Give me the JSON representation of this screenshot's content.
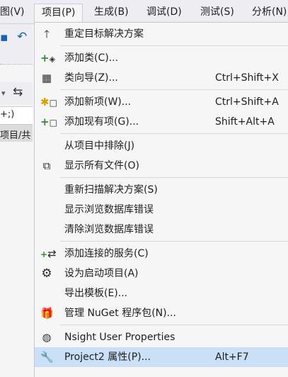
{
  "menubar": {
    "items": [
      "图(V)",
      "项目(P)",
      "生成(B)",
      "调试(D)",
      "测试(S)",
      "分析(N)"
    ]
  },
  "background": {
    "search_text": "+;)",
    "tree_row_text": "项目/共"
  },
  "menu": {
    "items": [
      {
        "label": "重定目标解决方案",
        "shortcut": "",
        "icon": "up-arrow-icon"
      },
      {
        "label": "添加类(C)...",
        "shortcut": "",
        "icon": "add-class-icon"
      },
      {
        "label": "类向导(Z)...",
        "shortcut": "Ctrl+Shift+X",
        "icon": "class-wizard-icon"
      },
      {
        "label": "添加新项(W)...",
        "shortcut": "Ctrl+Shift+A",
        "icon": "add-new-item-icon"
      },
      {
        "label": "添加现有项(G)...",
        "shortcut": "Shift+Alt+A",
        "icon": "add-existing-item-icon"
      },
      {
        "label": "从项目中排除(J)",
        "shortcut": "",
        "icon": ""
      },
      {
        "label": "显示所有文件(O)",
        "shortcut": "",
        "icon": "show-all-files-icon"
      },
      {
        "label": "重新扫描解决方案(S)",
        "shortcut": "",
        "icon": ""
      },
      {
        "label": "显示浏览数据库错误",
        "shortcut": "",
        "icon": ""
      },
      {
        "label": "清除浏览数据库错误",
        "shortcut": "",
        "icon": ""
      },
      {
        "label": "添加连接的服务(C)",
        "shortcut": "",
        "icon": "connected-service-icon"
      },
      {
        "label": "设为启动项目(A)",
        "shortcut": "",
        "icon": "gear-icon"
      },
      {
        "label": "导出模板(E)...",
        "shortcut": "",
        "icon": ""
      },
      {
        "label": "管理 NuGet 程序包(N)...",
        "shortcut": "",
        "icon": "nuget-package-icon"
      },
      {
        "label": "Nsight User Properties",
        "shortcut": "",
        "icon": "globe-icon"
      },
      {
        "label": "Project2 属性(P)...",
        "shortcut": "Alt+F7",
        "icon": "wrench-icon"
      }
    ]
  }
}
